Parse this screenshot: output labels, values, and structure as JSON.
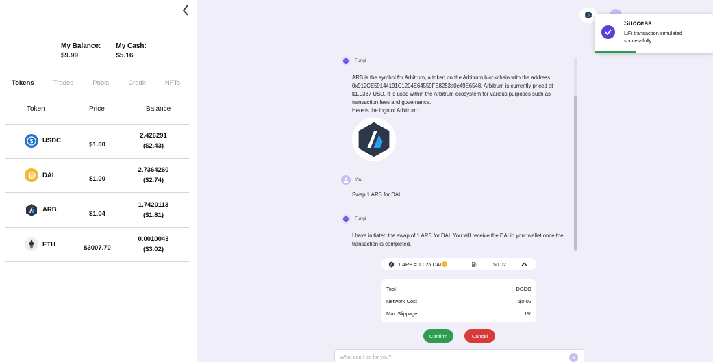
{
  "sidebar": {
    "my_balance_label": "My Balance:",
    "my_balance_value": "$9.99",
    "my_cash_label": "My Cash:",
    "my_cash_value": "$5.16",
    "tabs": [
      {
        "label": "Tokens",
        "active": true
      },
      {
        "label": "Trades",
        "active": false
      },
      {
        "label": "Pools",
        "active": false
      },
      {
        "label": "Credit",
        "active": false
      },
      {
        "label": "NFTs",
        "active": false
      }
    ],
    "table": {
      "headers": {
        "token": "Token",
        "price": "Price",
        "balance": "Balance"
      },
      "rows": [
        {
          "symbol": "USDC",
          "price": "$1.00",
          "amount": "2.426291",
          "value": "($2.43)",
          "icon": "usdc-icon"
        },
        {
          "symbol": "DAI",
          "price": "$1.00",
          "amount": "2.7364260",
          "value": "($2.74)",
          "icon": "dai-icon"
        },
        {
          "symbol": "ARB",
          "price": "$1.04",
          "amount": "1.7420113",
          "value": "($1.81)",
          "icon": "arbitrum-icon"
        },
        {
          "symbol": "ETH",
          "price": "$3007.70",
          "amount": "0.0010043",
          "value": "($3.02)",
          "icon": "ethereum-icon"
        }
      ]
    }
  },
  "toast": {
    "title": "Success",
    "message": "LiFi transaction simulated successfully"
  },
  "chat": {
    "messages": [
      {
        "sender": "Fungi",
        "lines": [
          "ARB is the symbol for Arbitrum, a token on the Arbitrum blockchain with the address 0x912CE59144191C1204E64559FE8253a0e49E6548. Arbitrum is currently priced at $1.0387 USD. It is used within the Arbitrum ecosystem for various purposes such as transaction fees and governance.",
          "Here is the logo of Arbitrum:"
        ]
      },
      {
        "sender": "You",
        "lines": [
          "Swap 1 ARB for DAI"
        ]
      },
      {
        "sender": "Fungi",
        "lines": [
          "I have initiated the swap of 1 ARB for DAI. You will receive the DAI in your wallet once the transaction is completed."
        ]
      }
    ]
  },
  "quote": {
    "rate": "1 ARB = 1.025 DAI",
    "gas": "$0.02"
  },
  "details": {
    "tool_label": "Tool",
    "tool_value": "DODO",
    "network_cost_label": "Network Cost",
    "network_cost_value": "$0.02",
    "max_slippage_label": "Max Slippage",
    "max_slippage_value": "1%"
  },
  "actions": {
    "confirm": "Confirm",
    "cancel": "Cancel"
  },
  "input": {
    "placeholder": "What can I do for you?"
  },
  "colors": {
    "accent": "#5b3fd6",
    "confirm": "#2e9b4e",
    "cancel": "#d83a3a",
    "background": "#efeef9"
  }
}
